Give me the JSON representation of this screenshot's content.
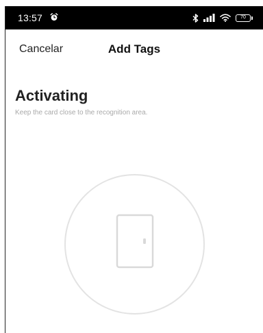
{
  "status_bar": {
    "time": "13:57",
    "battery_level": "70",
    "icons": [
      "alarm-icon",
      "bluetooth-icon",
      "signal-icon",
      "wifi-icon",
      "battery-icon"
    ]
  },
  "header": {
    "cancel_label": "Cancelar",
    "title": "Add Tags"
  },
  "main": {
    "heading": "Activating",
    "instruction": "Keep the card close to the recognition area.",
    "illustration_icon": "door-icon"
  },
  "colors": {
    "status_bar_bg": "#000000",
    "background": "#ffffff",
    "heading_text": "#222222",
    "subtext": "#a9a9a9",
    "circle_stroke": "#e3e3e3",
    "door_stroke": "#d9d9d9"
  }
}
